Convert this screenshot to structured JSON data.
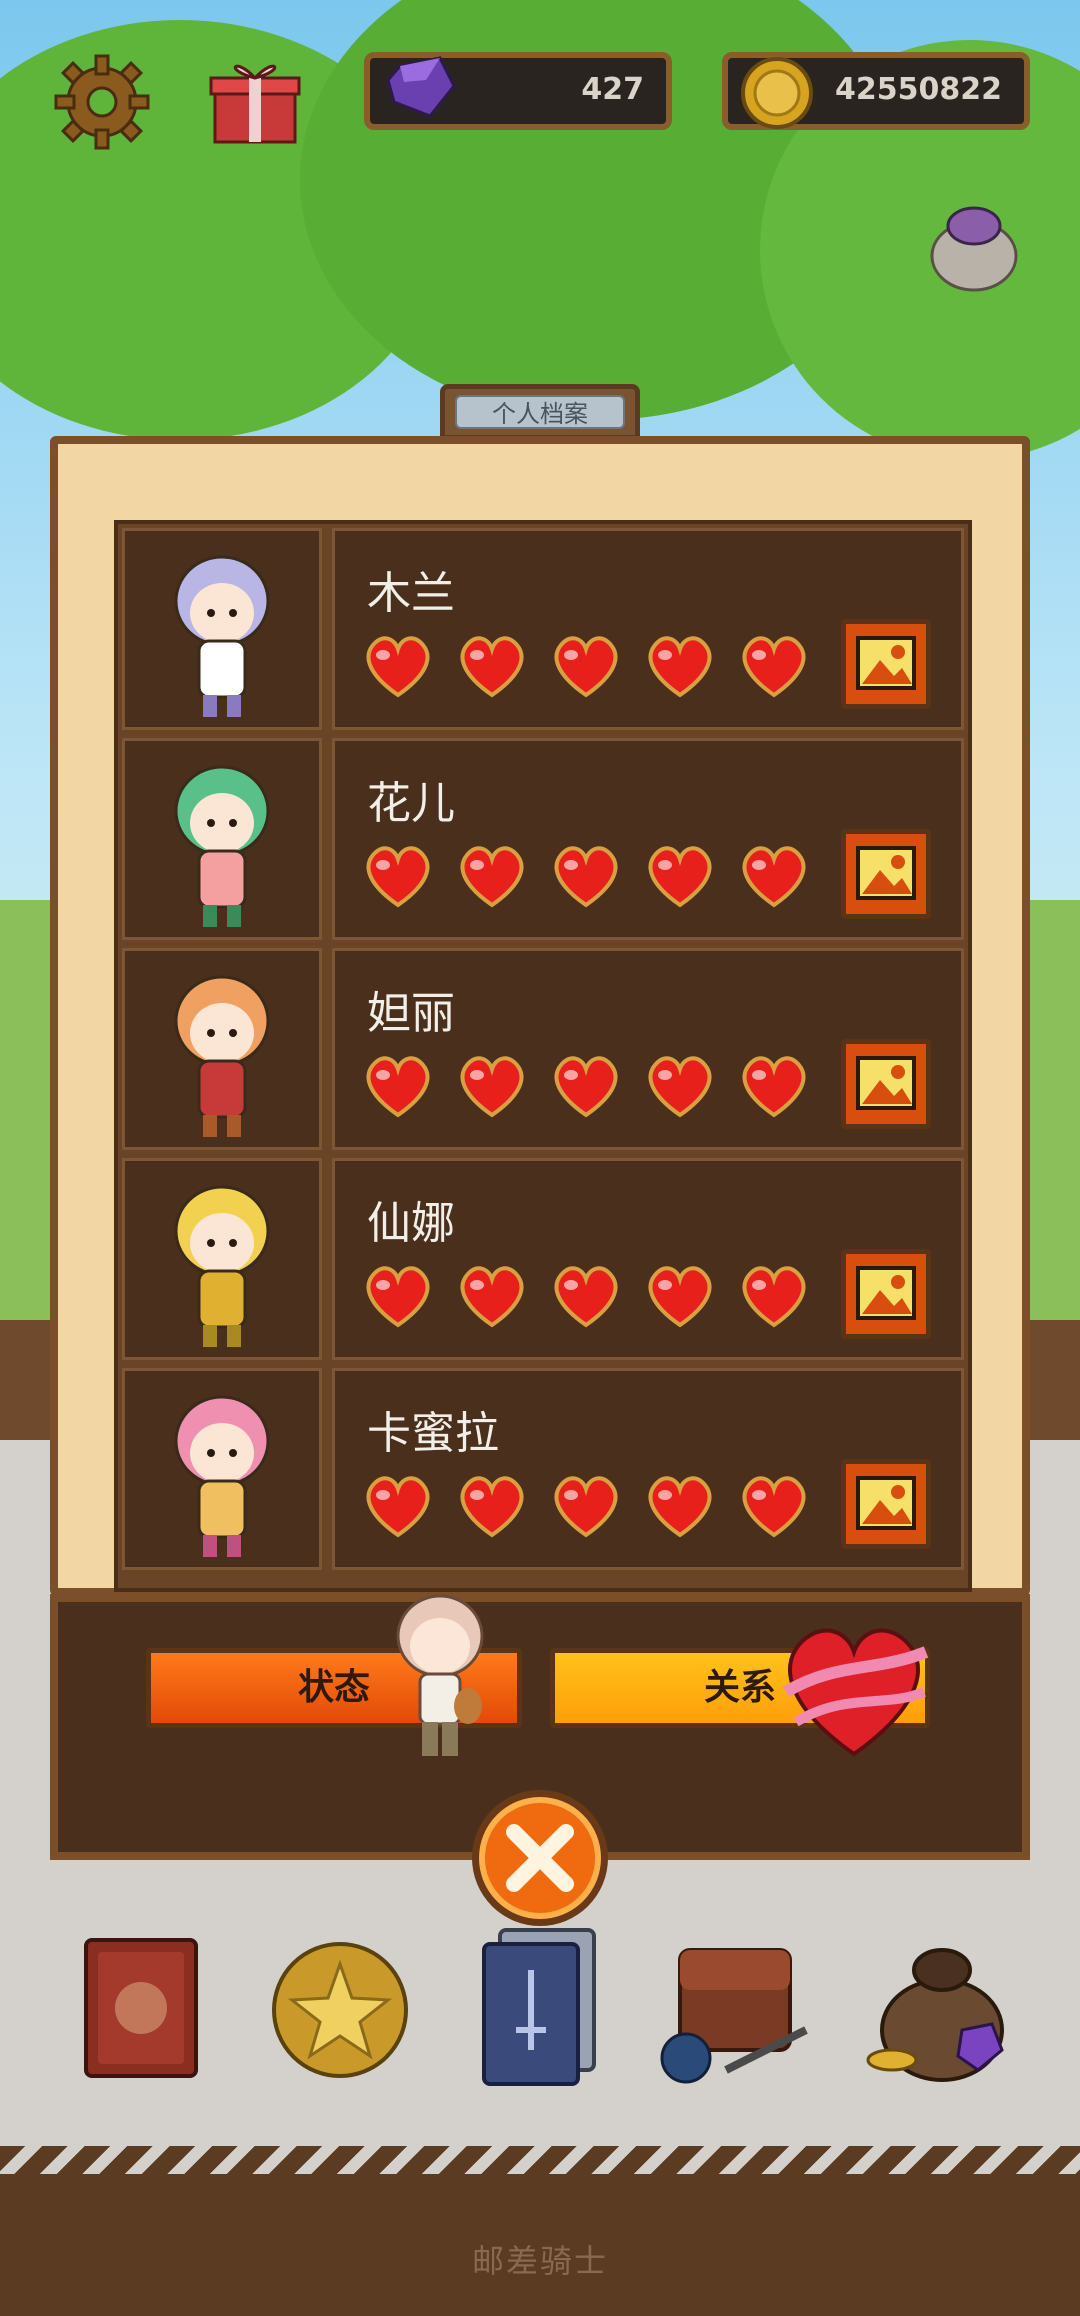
{
  "hud": {
    "gems": "427",
    "coins": "42550822",
    "gear_icon": "gear-icon",
    "gift_icon": "gift-icon",
    "gem_icon": "gem-icon",
    "coin_icon": "coin-icon"
  },
  "panel": {
    "tab_label": "个人档案",
    "characters": [
      {
        "name": "木兰",
        "hearts": 5,
        "max_hearts": 5
      },
      {
        "name": "花儿",
        "hearts": 5,
        "max_hearts": 5
      },
      {
        "name": "妲丽",
        "hearts": 5,
        "max_hearts": 5
      },
      {
        "name": "仙娜",
        "hearts": 5,
        "max_hearts": 5
      },
      {
        "name": "卡蜜拉",
        "hearts": 5,
        "max_hearts": 5
      }
    ],
    "status_label": "状态",
    "relation_label": "关系"
  },
  "toolbar": {
    "items": [
      "book-icon",
      "star-coin-icon",
      "cards-icon",
      "bag-icon",
      "loot-bag-icon"
    ]
  },
  "footer": {
    "title": "邮差骑士"
  },
  "colors": {
    "accent_orange": "#e24a08",
    "heart_red": "#e8201c",
    "panel_brown": "#4a2f1c"
  }
}
